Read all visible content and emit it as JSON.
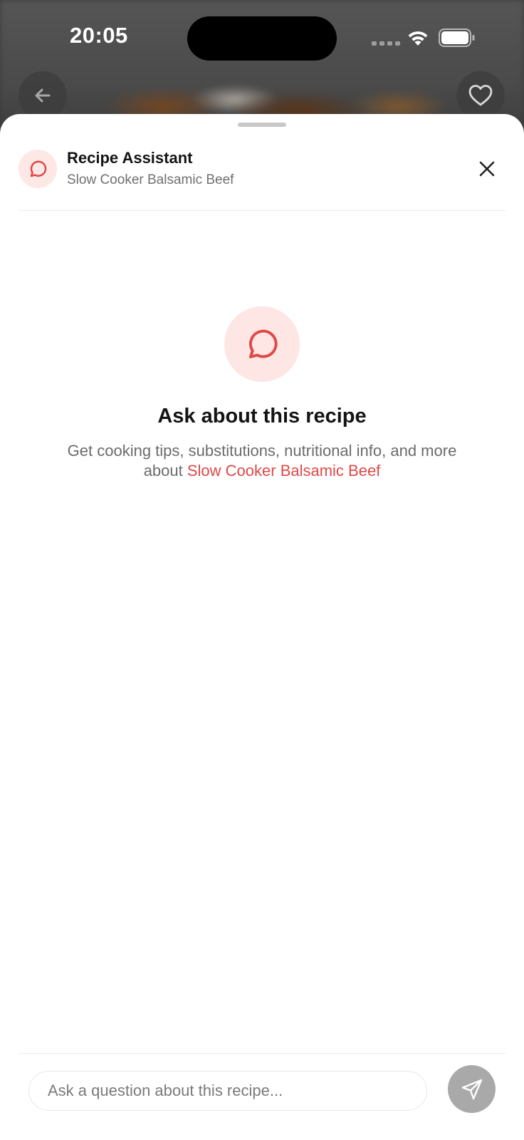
{
  "status_bar": {
    "time": "20:05"
  },
  "nav": {
    "back_icon": "arrow-left-icon",
    "favorite_icon": "heart-icon"
  },
  "sheet": {
    "header": {
      "icon": "chat-bubble-icon",
      "title": "Recipe Assistant",
      "subtitle": "Slow Cooker Balsamic Beef",
      "close_icon": "close-icon"
    },
    "empty_state": {
      "icon": "chat-bubble-icon",
      "title": "Ask about this recipe",
      "description_prefix": "Get cooking tips, substitutions, nutritional info, and more about ",
      "recipe_name": "Slow Cooker Balsamic Beef"
    },
    "composer": {
      "placeholder": "Ask a question about this recipe...",
      "send_icon": "send-icon"
    }
  },
  "colors": {
    "accent": "#e04848",
    "accent_light": "#fde6e3",
    "send_disabled": "#a9a9a9"
  }
}
